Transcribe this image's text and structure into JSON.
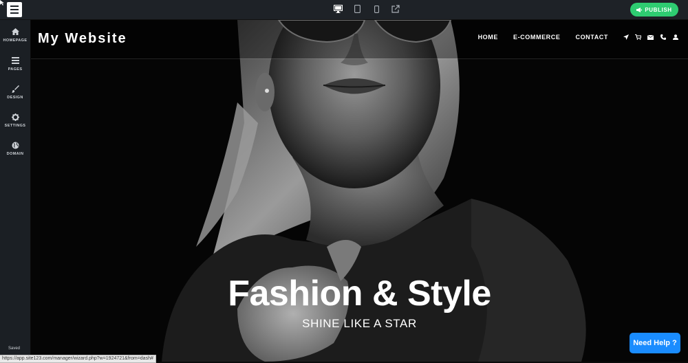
{
  "editor": {
    "publish_label": "PUBLISH",
    "saved_text": "Saved",
    "status_url": "https://app.site123.com/manager/wizard.php?w=1924721&from=dash#",
    "need_help_label": "Need Help ?",
    "device_icons": [
      "desktop-icon",
      "tablet-icon",
      "mobile-icon",
      "external-link-icon"
    ]
  },
  "sidebar": {
    "items": [
      {
        "label": "HOMEPAGE",
        "icon": "home-icon"
      },
      {
        "label": "PAGES",
        "icon": "pages-icon"
      },
      {
        "label": "DESIGN",
        "icon": "brush-icon"
      },
      {
        "label": "SETTINGS",
        "icon": "gear-icon"
      },
      {
        "label": "DOMAIN",
        "icon": "globe-icon"
      }
    ]
  },
  "site": {
    "logo": "My Website",
    "nav": [
      "HOME",
      "E-COMMERCE",
      "CONTACT"
    ],
    "nav_icons": [
      "location-arrow-icon",
      "cart-icon",
      "envelope-icon",
      "phone-icon",
      "user-icon"
    ],
    "hero_title": "Fashion & Style",
    "hero_subtitle": "SHINE LIKE A STAR"
  },
  "colors": {
    "publish": "#2ecc71",
    "need_help": "#1a8cff",
    "editor_bar": "#1e2227"
  }
}
